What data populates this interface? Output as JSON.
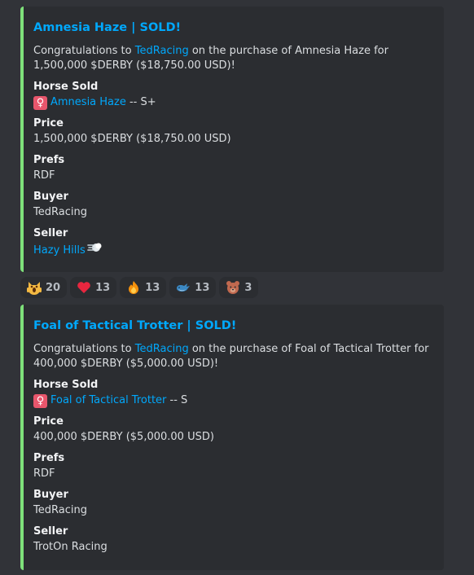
{
  "messages": [
    {
      "title": "Amnesia Haze | SOLD!",
      "desc": {
        "prefix": "Congratulations to ",
        "buyer_link": "TedRacing",
        "suffix": " on the purchase of Amnesia Haze for 1,500,000 $DERBY ($18,750.00 USD)!"
      },
      "fields": {
        "horse_sold": {
          "name": "Horse Sold",
          "link": "Amnesia Haze",
          "grade": " -- S+"
        },
        "price": {
          "name": "Price",
          "value": "1,500,000 $DERBY ($18,750.00 USD)"
        },
        "prefs": {
          "name": "Prefs",
          "value": "RDF"
        },
        "buyer": {
          "name": "Buyer",
          "value": "TedRacing"
        },
        "seller": {
          "name": "Seller",
          "value": "Hazy Hills"
        }
      }
    },
    {
      "title": "Foal of Tactical Trotter | SOLD!",
      "desc": {
        "prefix": "Congratulations to ",
        "buyer_link": "TedRacing",
        "suffix": " on the purchase of Foal of Tactical Trotter for 400,000 $DERBY ($5,000.00 USD)!"
      },
      "fields": {
        "horse_sold": {
          "name": "Horse Sold",
          "link": "Foal of Tactical Trotter",
          "grade": " -- S"
        },
        "price": {
          "name": "Price",
          "value": "400,000 $DERBY ($5,000.00 USD)"
        },
        "prefs": {
          "name": "Prefs",
          "value": "RDF"
        },
        "buyer": {
          "name": "Buyer",
          "value": "TedRacing"
        },
        "seller": {
          "name": "Seller",
          "value": "TrotOn Racing"
        }
      }
    }
  ],
  "reactions": [
    {
      "icon": "scream-cat-icon",
      "count": "20"
    },
    {
      "icon": "red-heart-icon",
      "count": "13"
    },
    {
      "icon": "fire-icon",
      "count": "13"
    },
    {
      "icon": "whale-icon",
      "count": "13"
    },
    {
      "icon": "bear-face-icon",
      "count": "3"
    }
  ],
  "female_glyph": "♀",
  "colors": {
    "background": "#313338",
    "embed_bg": "#2b2d31",
    "embed_border": "#7ee07a",
    "link": "#00a8fc",
    "text": "#dbdee1",
    "female_badge": "#e8566c"
  }
}
